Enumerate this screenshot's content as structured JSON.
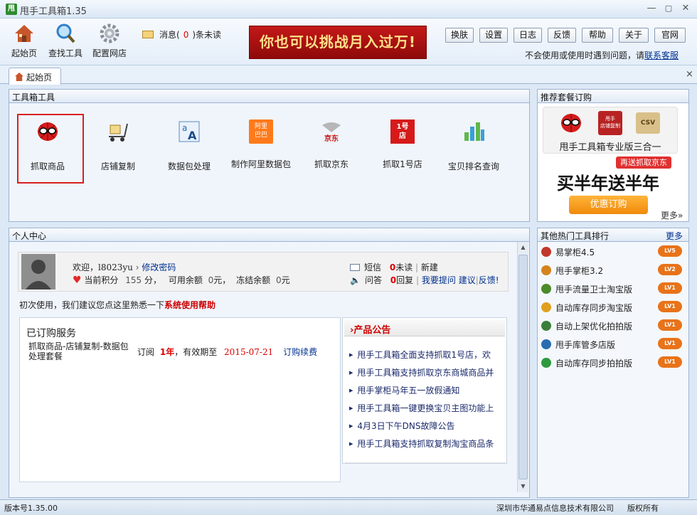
{
  "app": {
    "logo_text": "甩",
    "title": "甩手工具箱1.35"
  },
  "window": {
    "min": "—",
    "max": "▢",
    "close": "✕"
  },
  "toolbar": {
    "buttons": [
      {
        "label": "起始页",
        "icon": "home-icon"
      },
      {
        "label": "查找工具",
        "icon": "search-icon"
      },
      {
        "label": "配置网店",
        "icon": "gear-icon"
      }
    ],
    "message": {
      "prefix": "消息(",
      "count": "0",
      "suffix": ")条未读"
    },
    "banner": "你也可以挑战月入过万!",
    "small_buttons": [
      "换肤",
      "设置",
      "日志",
      "反馈",
      "帮助",
      "关于",
      "官网"
    ],
    "help_text": "不会使用或使用时遇到问题，请",
    "help_link": "联系客服"
  },
  "tabs": [
    {
      "label": "起始页"
    }
  ],
  "tab_close": "×",
  "toolbox": {
    "title": "工具箱工具",
    "tools": [
      {
        "label": "抓取商品",
        "selected": true
      },
      {
        "label": "店铺复制"
      },
      {
        "label": "数据包处理"
      },
      {
        "label": "制作阿里数据包",
        "icon_text": "阿里\n巴巴"
      },
      {
        "label": "抓取京东",
        "icon_text": "京东"
      },
      {
        "label": "抓取1号店",
        "icon_text": "1号\n店"
      },
      {
        "label": "宝贝排名查询"
      }
    ]
  },
  "promo": {
    "title": "推荐套餐订购",
    "icon_labels": {
      "shop": "甩手\n店铺复制",
      "csv": "CSV"
    },
    "package_name": "甩手工具箱专业版三合一",
    "tag": "再送抓取京东",
    "headline": "买半年送半年",
    "cta": "优惠订购",
    "more": "更多»"
  },
  "personal": {
    "title": "个人中心",
    "welcome": "欢迎，",
    "username": "l8023yu",
    "change_pwd": "修改密码",
    "points_label": "当前积分",
    "points": "155",
    "points_unit": "分，",
    "balance_label": "可用余额",
    "balance": "0",
    "balance_unit": "元，",
    "frozen_label": "冻结余额",
    "frozen": "0",
    "frozen_unit": "元",
    "sms_label": "短信",
    "sms_unread": "0",
    "sms_unread_label": "未读",
    "sms_new": "新建",
    "qa_label": "问答",
    "qa_reply": "0",
    "qa_reply_label": "回复",
    "qa_ask": "我要提问",
    "qa_suggest": "建议",
    "qa_feedback": "反馈!",
    "intro_text": "初次使用，我们建议您点这里熟悉一下",
    "intro_link": "系统使用帮助",
    "subscribed_title": "已订购服务",
    "service_name": "抓取商品-店铺复制-数据包处理套餐",
    "order_prefix": "订阅",
    "order_duration": "1年",
    "order_mid": "，有效期至",
    "order_expiry": "2015-07-21",
    "renew": "订购续费",
    "announce_title": "›产品公告",
    "announcements": [
      "甩手工具箱全面支持抓取1号店，欢",
      "甩手工具箱支持抓取京东商城商品并",
      "甩手掌柜马年五一放假通知",
      "甩手工具箱一键更换宝贝主图功能上",
      "4月3日下午DNS故障公告",
      "甩手工具箱支持抓取复制淘宝商品条"
    ]
  },
  "ranking": {
    "title": "其他热门工具排行",
    "more": "更多",
    "items": [
      {
        "label": "易掌柜4.5",
        "level": "LV5",
        "color": "#c0392b"
      },
      {
        "label": "甩手掌柜3.2",
        "level": "LV2",
        "color": "#d4841c"
      },
      {
        "label": "甩手流量卫士淘宝版",
        "level": "LV1",
        "color": "#4b8b2a"
      },
      {
        "label": "自动库存同步淘宝版",
        "level": "LV1",
        "color": "#e0a020"
      },
      {
        "label": "自动上架优化拍拍版",
        "level": "LV1",
        "color": "#3b7f3b"
      },
      {
        "label": "甩手库管多店版",
        "level": "LV1",
        "color": "#2a6cb0"
      },
      {
        "label": "自动库存同步拍拍版",
        "level": "LV1",
        "color": "#2e9a3e"
      }
    ]
  },
  "status": {
    "version": "版本号1.35.00",
    "company": "深圳市华通易点信息技术有限公司",
    "copyright": "版权所有"
  },
  "scroll": {
    "up": "▲",
    "down": "▼"
  }
}
